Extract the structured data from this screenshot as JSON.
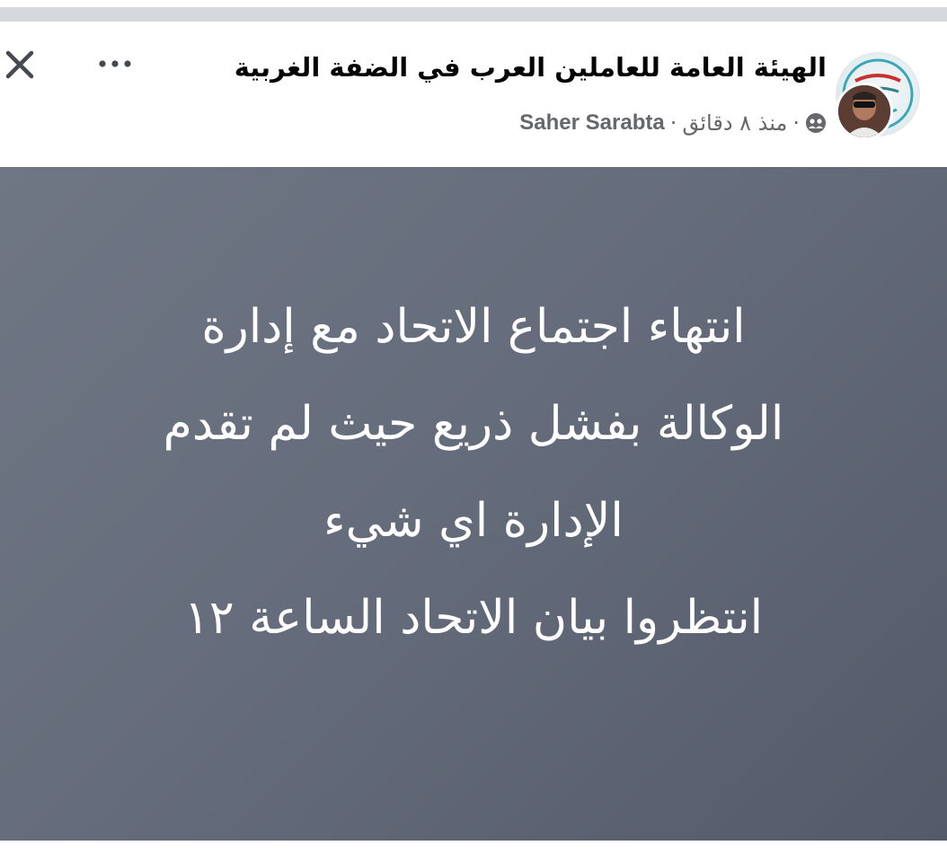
{
  "header": {
    "page_name": "الهيئة العامة للعاملين العرب في الضفة الغربية",
    "author": "Saher Sarabta",
    "separator": "·",
    "time_ago": "منذ ٨ دقائق",
    "privacy_icon": "group-icon",
    "close_icon": "close-icon",
    "more_icon": "more-dots-icon"
  },
  "post": {
    "lines": [
      "انتهاء اجتماع الاتحاد مع إدارة",
      "الوكالة بفشل ذريع حيث لم تقدم",
      "الإدارة اي شيء",
      "انتظروا بيان الاتحاد الساعة ١٢"
    ]
  },
  "colors": {
    "post_background_start": "#6f7684",
    "post_background_end": "#545a69",
    "post_text": "#ffffff",
    "meta_text": "#65676b"
  }
}
